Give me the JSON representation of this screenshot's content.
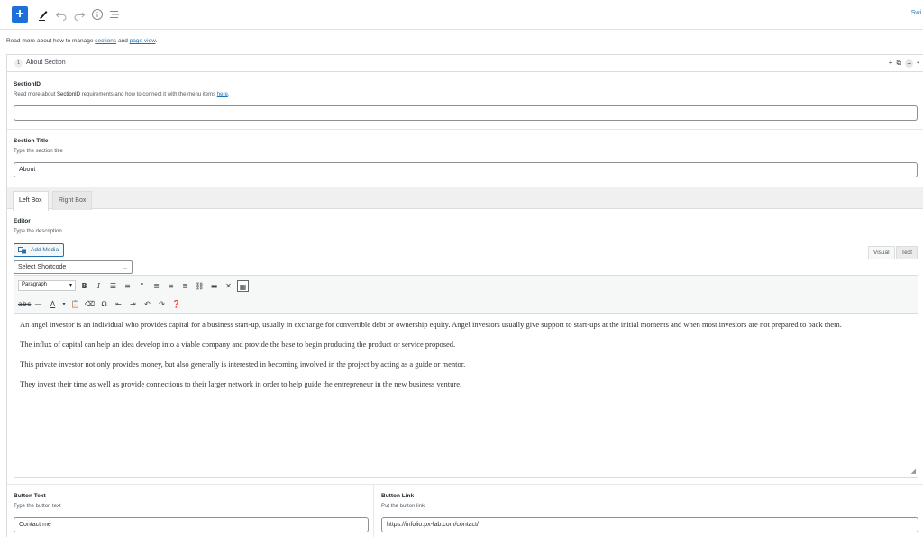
{
  "topbar": {
    "add_label": "+",
    "switch_label": "Swi"
  },
  "readmore": {
    "prefix": "Read more about how to manage ",
    "sections_link": "sections",
    "middle": " and ",
    "page_view_link": "page view",
    "suffix": "."
  },
  "section": {
    "number": "1",
    "title": "About Section",
    "actions": [
      "+",
      "⧉",
      "−",
      "•"
    ]
  },
  "section_id": {
    "label": "SectionID",
    "desc_prefix": "Read more about ",
    "desc_bold": "SectionID",
    "desc_mid": " requirements and how to connect it with the menu items ",
    "desc_link": "here",
    "desc_suffix": ".",
    "value": ""
  },
  "section_title": {
    "label": "Section Title",
    "desc": "Type the section title",
    "value": "About"
  },
  "tabs": [
    {
      "label": "Left Box",
      "active": true
    },
    {
      "label": "Right Box",
      "active": false
    }
  ],
  "editor": {
    "label": "Editor",
    "desc": "Type the description",
    "add_media": "Add Media",
    "shortcode": "Select Shortcode",
    "mode_visual": "Visual",
    "mode_text": "Text",
    "format": "Paragraph",
    "paragraphs": [
      "An angel investor is an individual who provides capital for a business start-up, usually in exchange for convertible debt or ownership equity. Angel investors usually give support to start-ups at the initial moments and when most investors are not prepared to back them.",
      "The influx of capital can help an idea develop into a viable company and provide the base to begin producing the product or service proposed.",
      "This private investor not only provides money, but also generally is interested in becoming involved in the project by acting as a guide or mentor.",
      "They invest their time as well as provide connections to their larger network in order to help guide the entrepreneur in the new business venture."
    ]
  },
  "button_text": {
    "label": "Button Text",
    "desc": "Type the button text",
    "value": "Contact me"
  },
  "button_link": {
    "label": "Button Link",
    "desc": "Put the button link",
    "value": "https://infolio.px-lab.com/contact/"
  }
}
